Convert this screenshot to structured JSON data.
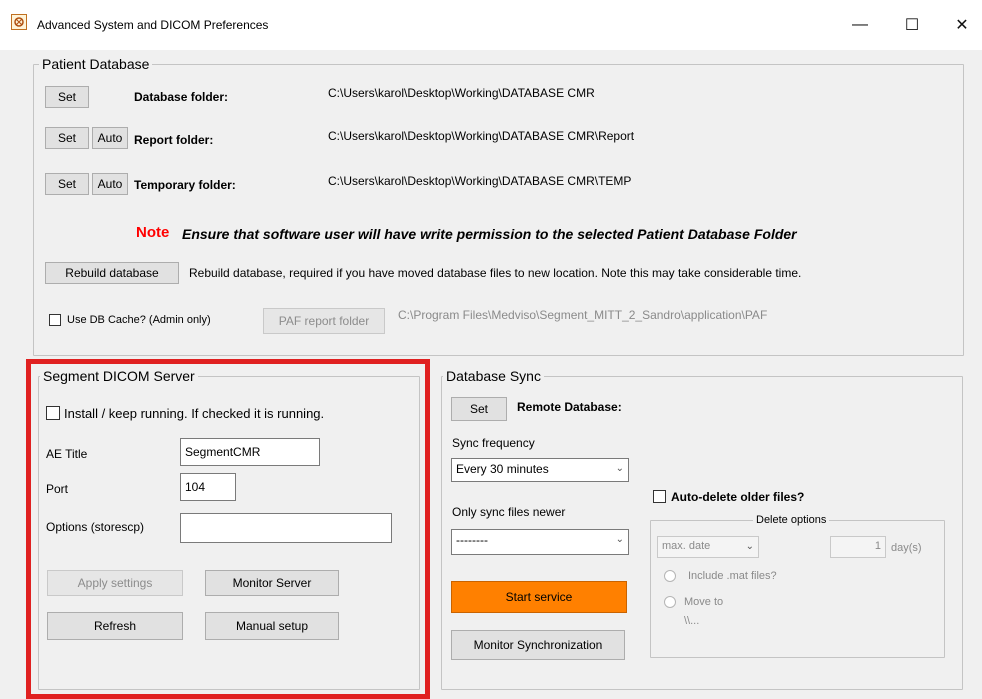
{
  "window": {
    "title": "Advanced System and DICOM Preferences",
    "minimize": "—",
    "maximize": "☐",
    "close": "✕"
  },
  "patient_db": {
    "group_title": "Patient Database",
    "set": "Set",
    "auto": "Auto",
    "database_label": "Database folder:",
    "database_path": "C:\\Users\\karol\\Desktop\\Working\\DATABASE CMR",
    "report_label": "Report folder:",
    "report_path": "C:\\Users\\karol\\Desktop\\Working\\DATABASE CMR\\Report",
    "temp_label": "Temporary folder:",
    "temp_path": "C:\\Users\\karol\\Desktop\\Working\\DATABASE CMR\\TEMP",
    "note_word": "Note",
    "note_text": "Ensure that software user will have write permission to the selected Patient Database Folder",
    "rebuild_button": "Rebuild database",
    "rebuild_text": "Rebuild database, required if you have moved database files to new location. Note this may take considerable time.",
    "db_cache_label": "Use DB Cache? (Admin only)",
    "paf_button": "PAF report folder",
    "paf_path": "C:\\Program Files\\Medviso\\Segment_MITT_2_Sandro\\application\\PAF"
  },
  "dicom_server": {
    "group_title": "Segment DICOM Server",
    "install_label": "Install / keep running. If checked it is running.",
    "ae_title_label": "AE Title",
    "ae_title_value": "SegmentCMR",
    "port_label": "Port",
    "port_value": "104",
    "options_label": "Options (storescp)",
    "options_value": "",
    "apply_button": "Apply settings",
    "monitor_button": "Monitor Server",
    "refresh_button": "Refresh",
    "manual_button": "Manual setup"
  },
  "db_sync": {
    "group_title": "Database Sync",
    "set": "Set",
    "remote_label": "Remote Database:",
    "sync_freq_label": "Sync frequency",
    "sync_freq_value": "Every 30 minutes",
    "newer_label": "Only sync files newer",
    "newer_value": "--------",
    "auto_delete_label": "Auto-delete older files?",
    "delete_options_title": "Delete options",
    "max_date_value": "max. date",
    "days_value": "1",
    "days_unit": "day(s)",
    "include_mat_label": "Include .mat files?",
    "move_to_label": "Move to",
    "move_to_path": "\\\\...",
    "start_button": "Start service",
    "monitor_sync_button": "Monitor Synchronization"
  }
}
